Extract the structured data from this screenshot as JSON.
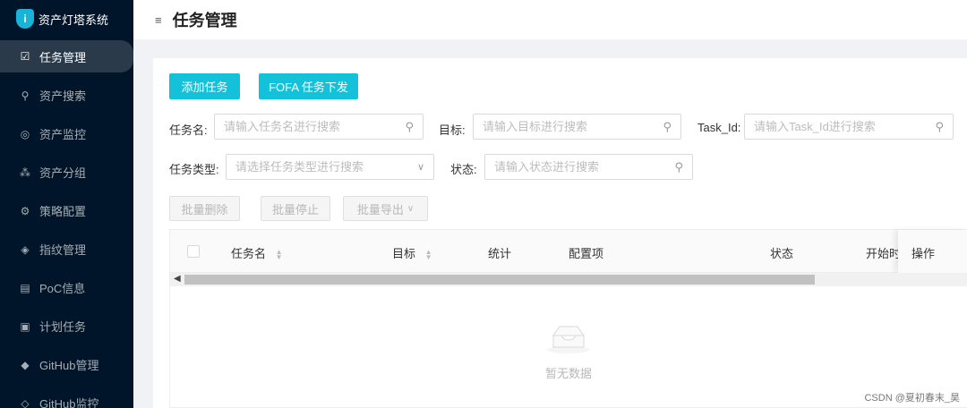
{
  "app": {
    "title": "资产灯塔系统",
    "logo_letter": "i"
  },
  "sidebar": {
    "items": [
      {
        "label": "任务管理",
        "icon": "☑",
        "active": true
      },
      {
        "label": "资产搜索",
        "icon": "⚲"
      },
      {
        "label": "资产监控",
        "icon": "◎"
      },
      {
        "label": "资产分组",
        "icon": "⁂"
      },
      {
        "label": "策略配置",
        "icon": "⚙"
      },
      {
        "label": "指纹管理",
        "icon": "◈"
      },
      {
        "label": "PoC信息",
        "icon": "▤"
      },
      {
        "label": "计划任务",
        "icon": "▣"
      },
      {
        "label": "GitHub管理",
        "icon": "◆"
      },
      {
        "label": "GitHub监控",
        "icon": "◇"
      }
    ]
  },
  "header": {
    "title": "任务管理",
    "fold_icon": "≡"
  },
  "toolbar": {
    "add_task": "添加任务",
    "fofa_task": "FOFA 任务下发"
  },
  "filters": {
    "task_name_label": "任务名:",
    "task_name_placeholder": "请输入任务名进行搜索",
    "target_label": "目标:",
    "target_placeholder": "请输入目标进行搜索",
    "task_id_label": "Task_Id:",
    "task_id_placeholder": "请输入Task_Id进行搜索",
    "task_type_label": "任务类型:",
    "task_type_placeholder": "请选择任务类型进行搜索",
    "status_label": "状态:",
    "status_placeholder": "请输入状态进行搜索"
  },
  "batch": {
    "delete": "批量删除",
    "stop": "批量停止",
    "export": "批量导出"
  },
  "table": {
    "columns": [
      "任务名",
      "目标",
      "统计",
      "配置项",
      "状态",
      "开始时",
      "操作"
    ],
    "empty_text": "暂无数据"
  },
  "watermark": "CSDN @夏初春末_昊"
}
